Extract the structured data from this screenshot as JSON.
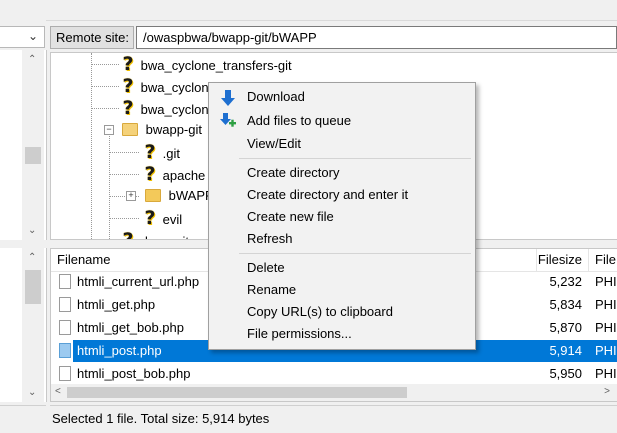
{
  "remote": {
    "label": "Remote site:",
    "path": "/owaspbwa/bwapp-git/bWAPP"
  },
  "tree": {
    "items": [
      {
        "label": "bwa_cyclone_transfers-git",
        "icon": "question-mark-icon"
      },
      {
        "label": "bwa_cyclon",
        "icon": "question-mark-icon"
      },
      {
        "label": "bwa_cyclon",
        "icon": "question-mark-icon"
      },
      {
        "label": "bwapp-git",
        "icon": "folder-icon"
      },
      {
        "label": ".git",
        "icon": "question-mark-icon"
      },
      {
        "label": "apache",
        "icon": "question-mark-icon"
      },
      {
        "label": "bWAPP",
        "icon": "folder-icon"
      },
      {
        "label": "evil",
        "icon": "question-mark-icon"
      },
      {
        "label": "dvwa-git",
        "icon": "question-mark-icon"
      }
    ]
  },
  "file_list": {
    "columns": [
      "Filename",
      "Filesize",
      "File"
    ],
    "rows": [
      {
        "name": "htmli_current_url.php",
        "size": "5,232",
        "type": "PHI"
      },
      {
        "name": "htmli_get.php",
        "size": "5,834",
        "type": "PHI"
      },
      {
        "name": "htmli_get_bob.php",
        "size": "5,870",
        "type": "PHI"
      },
      {
        "name": "htmli_post.php",
        "size": "5,914",
        "type": "PHI",
        "selected": true
      },
      {
        "name": "htmli_post_bob.php",
        "size": "5,950",
        "type": "PHI"
      }
    ]
  },
  "status": {
    "text": "Selected 1 file. Total size: 5,914 bytes"
  },
  "context_menu": {
    "download": "Download",
    "add_queue": "Add files to queue",
    "view_edit": "View/Edit",
    "create_dir": "Create directory",
    "create_dir_enter": "Create directory and enter it",
    "create_file": "Create new file",
    "refresh": "Refresh",
    "delete": "Delete",
    "rename": "Rename",
    "copy_url": "Copy URL(s) to clipboard",
    "permissions": "File permissions..."
  },
  "colors": {
    "selection": "#0078d7",
    "folder": "#f5d27a",
    "download_arrow": "#1e6fd0",
    "queue_plus": "#2ea043"
  }
}
